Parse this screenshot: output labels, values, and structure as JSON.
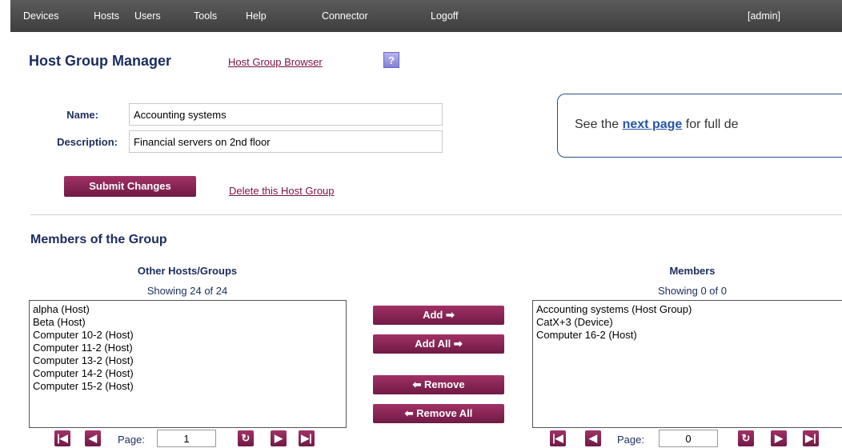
{
  "nav": {
    "items": [
      "Devices",
      "Hosts",
      "Users",
      "Tools",
      "Help",
      "Connector",
      "Logoff"
    ],
    "user": "[admin]"
  },
  "header": {
    "title": "Host Group Manager",
    "browser_link": "Host Group Browser",
    "help_label": "?"
  },
  "form": {
    "name_label": "Name:",
    "name_value": "Accounting systems",
    "description_label": "Description:",
    "description_value": "Financial servers on 2nd floor",
    "submit_label": "Submit Changes",
    "delete_link": "Delete this Host Group"
  },
  "callout": {
    "prefix": "See the ",
    "link": "next page",
    "suffix": " for full de"
  },
  "members": {
    "section_title": "Members of the Group",
    "left": {
      "heading": "Other Hosts/Groups",
      "count": "Showing 24 of 24",
      "items": [
        "alpha (Host)",
        "Beta (Host)",
        "Computer 10-2 (Host)",
        "Computer 11-2 (Host)",
        "Computer 13-2 (Host)",
        "Computer 14-2 (Host)",
        "Computer 15-2 (Host)"
      ],
      "page_label": "Page:",
      "page_value": "1"
    },
    "right": {
      "heading": "Members",
      "count": "Showing 0 of 0",
      "items": [
        "Accounting systems (Host Group)",
        "CatX+3 (Device)",
        "Computer 16-2 (Host)"
      ],
      "page_label": "Page:",
      "page_value": "0"
    },
    "buttons": {
      "add": "Add",
      "add_all": "Add All",
      "remove": "Remove",
      "remove_all": "Remove All"
    }
  },
  "colors": {
    "button": "#8a2456",
    "heading": "#1a2d5c",
    "link": "#7a1340",
    "topbar": "#4a4a4a"
  }
}
